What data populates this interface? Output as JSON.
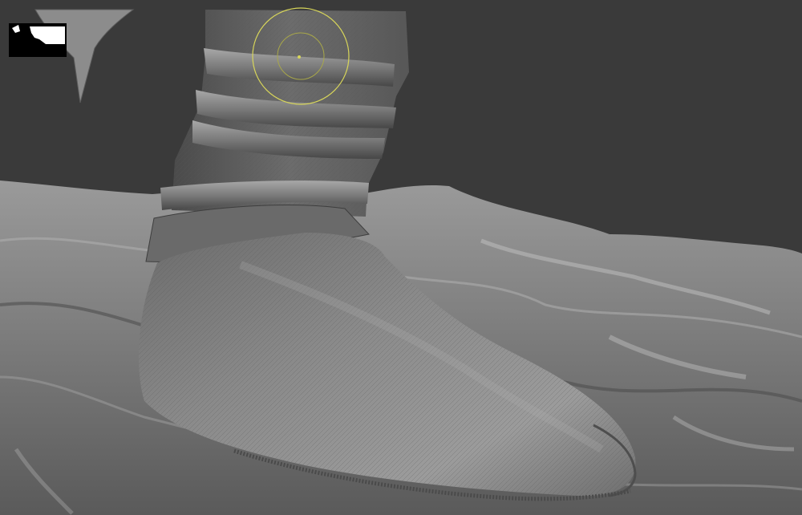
{
  "app": {
    "kind": "3D sculpting viewport",
    "accent_color": "#f0b429",
    "background_color": "#3a3a3a"
  },
  "viewport": {
    "model": "boot-sculpt",
    "brush_cursor_color": "#d8d65a",
    "icons": [
      "brush-cursor-icon",
      "navigation-widget-icon"
    ]
  }
}
